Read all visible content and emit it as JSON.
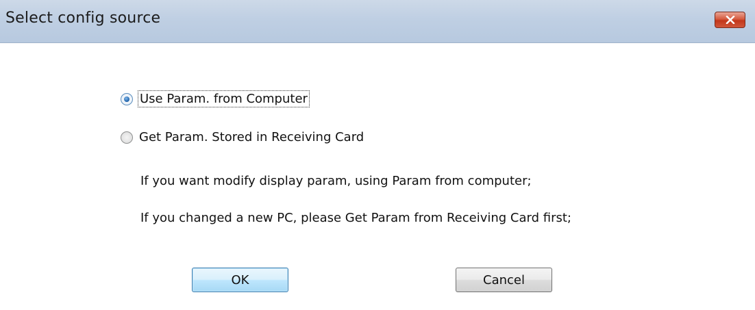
{
  "window": {
    "title": "Select config source",
    "close_icon": "close-x-icon"
  },
  "options": [
    {
      "label": "Use Param. from Computer",
      "checked": true
    },
    {
      "label": "Get Param. Stored in Receiving Card",
      "checked": false
    }
  ],
  "info_lines": [
    "If you  want modify display param, using Param from computer;",
    "If you changed a new PC, please Get Param from Receiving Card first;"
  ],
  "buttons": {
    "ok_label": "OK",
    "cancel_label": "Cancel"
  },
  "colors": {
    "titlebar": "#bfcfe3",
    "close_button": "#c2371b",
    "radio_selected": "#1d5fa6",
    "default_button_border": "#3c7fb1"
  }
}
